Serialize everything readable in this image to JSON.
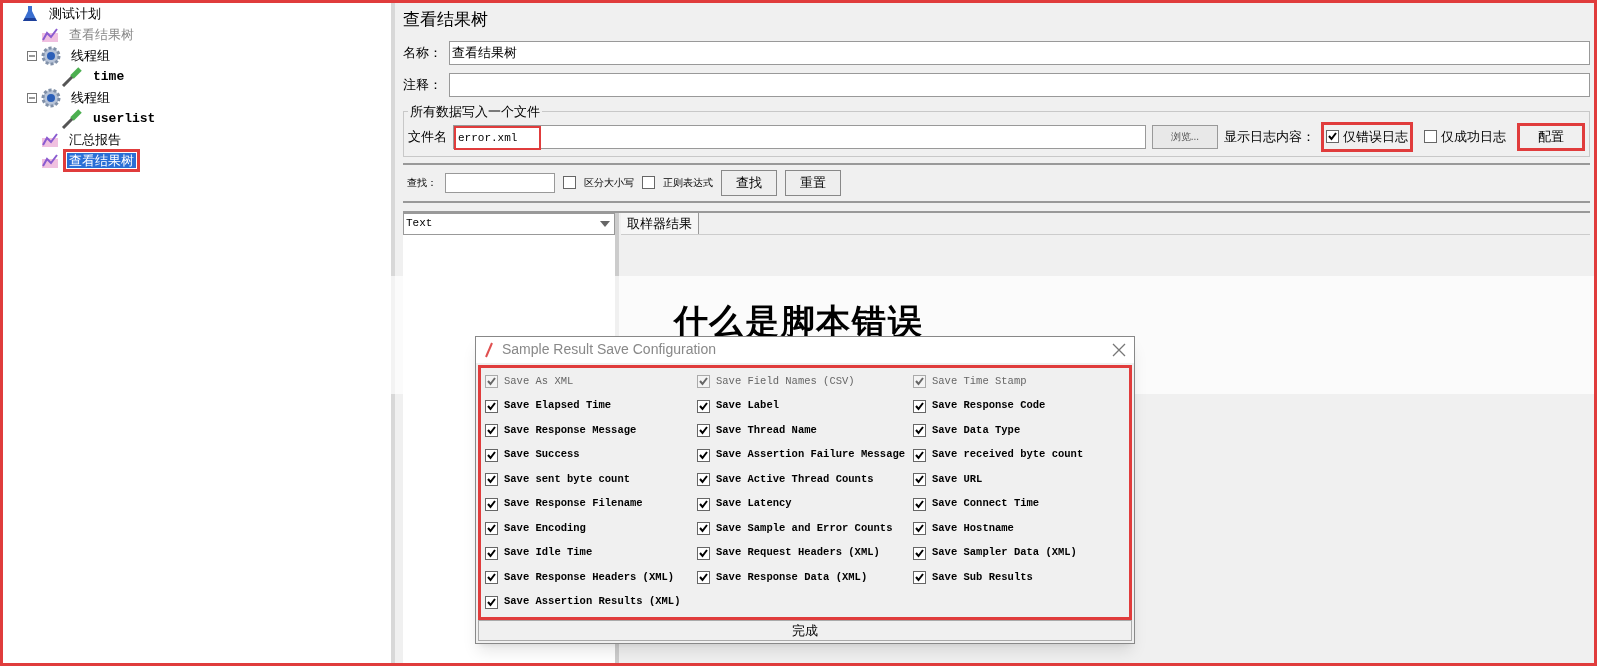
{
  "tree": [
    {
      "label": "测试计划",
      "kind": "plan",
      "highlighted": false,
      "selected": false,
      "disabled": false,
      "children": [
        {
          "label": "查看结果树",
          "kind": "listener",
          "disabled": true,
          "selected": false,
          "highlighted": false
        },
        {
          "label": "线程组",
          "kind": "thread_group",
          "disabled": false,
          "selected": false,
          "highlighted": false,
          "expanded": true,
          "children": [
            {
              "label": "time",
              "kind": "sampler",
              "disabled": false,
              "selected": false,
              "highlighted": false
            }
          ]
        },
        {
          "label": "线程组",
          "kind": "thread_group",
          "disabled": false,
          "selected": false,
          "highlighted": false,
          "expanded": true,
          "children": [
            {
              "label": "userlist",
              "kind": "sampler",
              "disabled": false,
              "selected": false,
              "highlighted": false
            }
          ]
        },
        {
          "label": "汇总报告",
          "kind": "listener",
          "disabled": false,
          "selected": false,
          "highlighted": false
        },
        {
          "label": "查看结果树",
          "kind": "listener",
          "disabled": false,
          "selected": true,
          "highlighted": true
        }
      ]
    }
  ],
  "panel": {
    "title": "查看结果树",
    "name": {
      "label": "名称：",
      "value": "查看结果树"
    },
    "comment": {
      "label": "注释："
    },
    "file_group": {
      "title": "所有数据写入一个文件",
      "file_label": "文件名",
      "file_value": "error.xml",
      "file_highlighted": true,
      "browse": "浏览...",
      "log_label": "显示日志内容：",
      "options": [
        {
          "label": "仅错误日志",
          "checked": true,
          "highlighted": true
        },
        {
          "label": "仅成功日志",
          "checked": false,
          "highlighted": false
        }
      ],
      "config": {
        "label": "配置",
        "highlighted": true
      }
    },
    "search": {
      "label": "查找：",
      "options": [
        {
          "label": "区分大小写",
          "checked": false
        },
        {
          "label": "正则表达式",
          "checked": false
        }
      ],
      "buttons": [
        "查找",
        "重置"
      ]
    },
    "renderer": "Text",
    "tabs": [
      {
        "label": "取样器结果",
        "selected": true
      }
    ]
  },
  "overlay_title": "什么是脚本错误",
  "dialog": {
    "title": "Sample Result Save Configuration",
    "highlighted": true,
    "done": "完成",
    "options": [
      {
        "label": "Save As XML",
        "checked": true,
        "disabled": true
      },
      {
        "label": "Save Field Names (CSV)",
        "checked": true,
        "disabled": true
      },
      {
        "label": "Save Time Stamp",
        "checked": true,
        "disabled": true
      },
      {
        "label": "Save Elapsed Time",
        "checked": true,
        "disabled": false
      },
      {
        "label": "Save Label",
        "checked": true,
        "disabled": false
      },
      {
        "label": "Save Response Code",
        "checked": true,
        "disabled": false
      },
      {
        "label": "Save Response Message",
        "checked": true,
        "disabled": false
      },
      {
        "label": "Save Thread Name",
        "checked": true,
        "disabled": false
      },
      {
        "label": "Save Data Type",
        "checked": true,
        "disabled": false
      },
      {
        "label": "Save Success",
        "checked": true,
        "disabled": false
      },
      {
        "label": "Save Assertion Failure Message",
        "checked": true,
        "disabled": false
      },
      {
        "label": "Save received byte count",
        "checked": true,
        "disabled": false
      },
      {
        "label": "Save sent byte count",
        "checked": true,
        "disabled": false
      },
      {
        "label": "Save Active Thread Counts",
        "checked": true,
        "disabled": false
      },
      {
        "label": "Save URL",
        "checked": true,
        "disabled": false
      },
      {
        "label": "Save Response Filename",
        "checked": true,
        "disabled": false
      },
      {
        "label": "Save Latency",
        "checked": true,
        "disabled": false
      },
      {
        "label": "Save Connect Time",
        "checked": true,
        "disabled": false
      },
      {
        "label": "Save Encoding",
        "checked": true,
        "disabled": false
      },
      {
        "label": "Save Sample and Error Counts",
        "checked": true,
        "disabled": false
      },
      {
        "label": "Save Hostname",
        "checked": true,
        "disabled": false
      },
      {
        "label": "Save Idle Time",
        "checked": true,
        "disabled": false
      },
      {
        "label": "Save Request Headers (XML)",
        "checked": true,
        "disabled": false
      },
      {
        "label": "Save Sampler Data (XML)",
        "checked": true,
        "disabled": false
      },
      {
        "label": "Save Response Headers (XML)",
        "checked": true,
        "disabled": false
      },
      {
        "label": "Save Response Data (XML)",
        "checked": true,
        "disabled": false
      },
      {
        "label": "Save Sub Results",
        "checked": true,
        "disabled": false
      },
      {
        "label": "Save Assertion Results (XML)",
        "checked": true,
        "disabled": false
      }
    ]
  }
}
